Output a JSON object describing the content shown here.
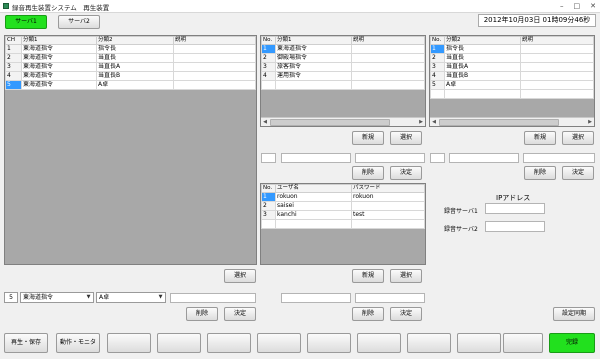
{
  "window": {
    "title": "録音再生装置システム　再生装置"
  },
  "tabs": [
    "サーバ1",
    "サーバ2"
  ],
  "clock": "2012年10月03日 01時09分46秒",
  "grid_main": {
    "headers": [
      "CH",
      "分類1",
      "分類2",
      "説明"
    ],
    "rows": [
      [
        "1",
        "東海道指令",
        "指令長",
        ""
      ],
      [
        "2",
        "東海道指令",
        "当直長",
        ""
      ],
      [
        "3",
        "東海道指令",
        "当直長A",
        ""
      ],
      [
        "4",
        "東海道指令",
        "当直長B",
        ""
      ],
      [
        "5",
        "東海道指令",
        "A卓",
        ""
      ]
    ]
  },
  "grid_class1": {
    "headers": [
      "No.",
      "分類1",
      "説明"
    ],
    "rows": [
      [
        "1",
        "東海道指令",
        ""
      ],
      [
        "2",
        "御殿場指令",
        ""
      ],
      [
        "3",
        "旅客指令",
        ""
      ],
      [
        "4",
        "運用指令",
        ""
      ]
    ]
  },
  "grid_class2": {
    "headers": [
      "No.",
      "分類2",
      "説明"
    ],
    "rows": [
      [
        "1",
        "指令長",
        ""
      ],
      [
        "2",
        "当直長",
        ""
      ],
      [
        "3",
        "当直長A",
        ""
      ],
      [
        "4",
        "当直長B",
        ""
      ],
      [
        "5",
        "A卓",
        ""
      ]
    ]
  },
  "grid_users": {
    "headers": [
      "No.",
      "ユーザ名",
      "パスワード"
    ],
    "rows": [
      [
        "1",
        "rokuon",
        "rokuon"
      ],
      [
        "2",
        "saisei",
        ""
      ],
      [
        "3",
        "kanchi",
        "test"
      ]
    ]
  },
  "buttons": {
    "new": "新規",
    "select": "選択",
    "delete": "削除",
    "confirm": "決定",
    "sync": "設定同期",
    "playback_save": "再生・保存",
    "action_monitor": "動作・モニタ",
    "complete": "完録"
  },
  "ip": {
    "title": "IPアドレス",
    "server1_label": "録音サーバ1",
    "server2_label": "録音サーバ2"
  },
  "edit_row": {
    "ch_value": "5",
    "class1_value": "東海道指令",
    "class2_value": "A卓"
  },
  "colors": {
    "accent_green": "#22e01e",
    "selection": "#3399ff"
  }
}
